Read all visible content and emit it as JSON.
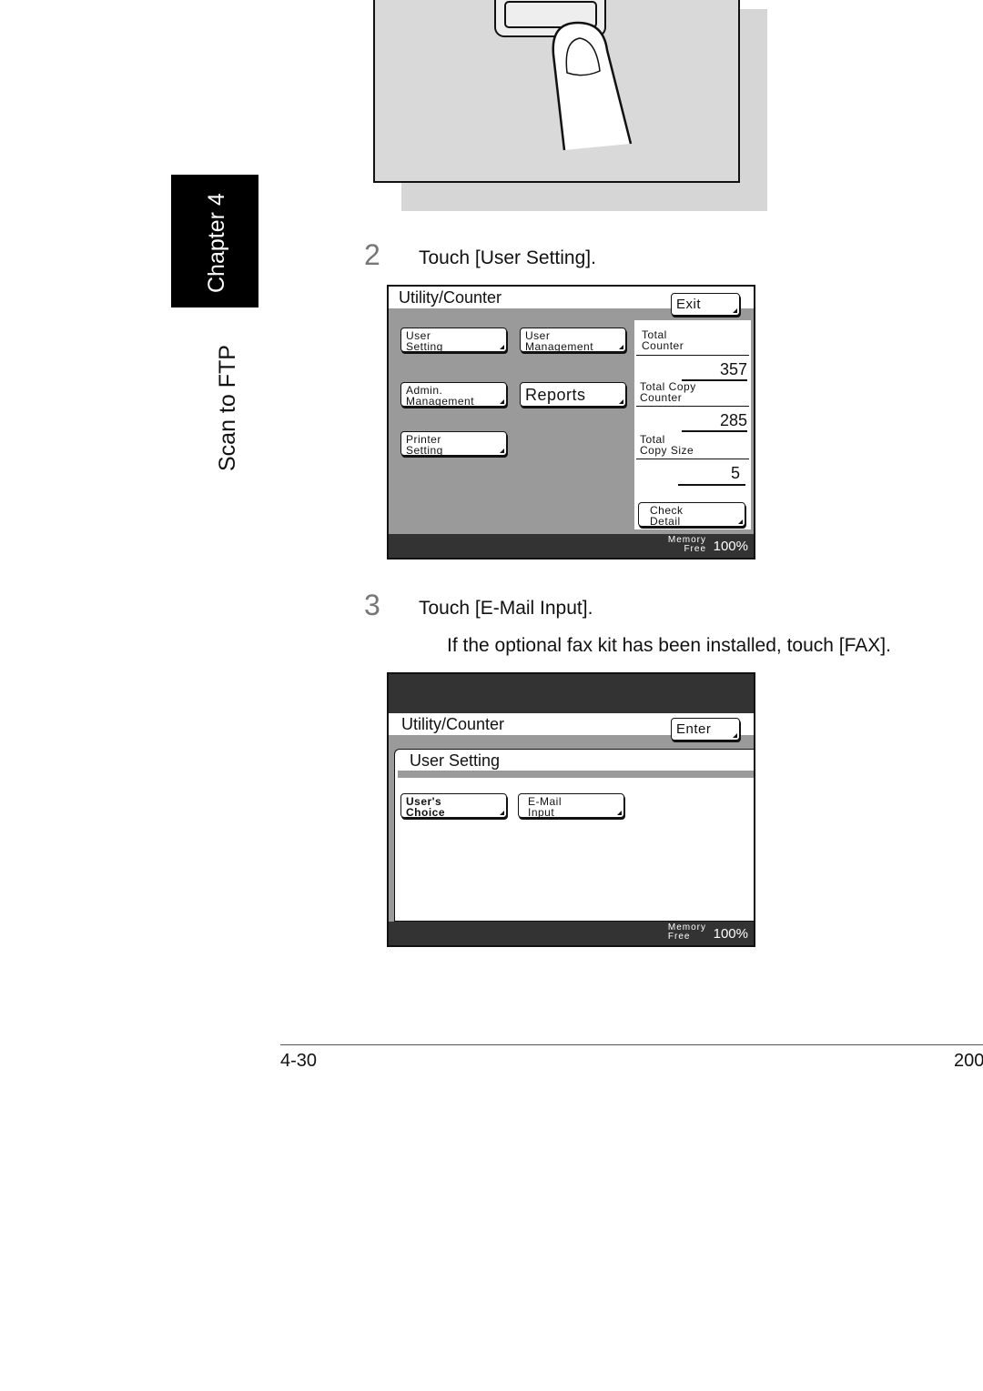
{
  "sidebar": {
    "chapter": "Chapter 4",
    "section": "Scan to FTP"
  },
  "steps": [
    {
      "number": "2",
      "text": "Touch [User Setting]."
    },
    {
      "number": "3",
      "text": "Touch [E-Mail Input].",
      "note": "If the optional fax kit has been installed, touch [FAX]."
    }
  ],
  "panel1": {
    "title": "Utility/Counter",
    "exit": "Exit",
    "buttons": [
      "User\nSetting",
      "User\nManagement",
      "Admin.\nManagement",
      "Reports",
      "Printer\nSetting"
    ],
    "counters": [
      {
        "label": "Total\nCounter",
        "value": "357"
      },
      {
        "label": "Total Copy\nCounter",
        "value": "285"
      },
      {
        "label": "Total\nCopy Size",
        "value": "5"
      }
    ],
    "check_detail": "Check\nDetail",
    "memory_label": "Memory\nFree",
    "memory_value": "100%"
  },
  "panel2": {
    "title": "Utility/Counter",
    "enter": "Enter",
    "subtitle": "User Setting",
    "buttons": [
      "User's\nChoice",
      "E-Mail\nInput"
    ],
    "memory_label": "Memory\nFree",
    "memory_value": "100%"
  },
  "footer": {
    "page": "4-30",
    "right": "200"
  }
}
